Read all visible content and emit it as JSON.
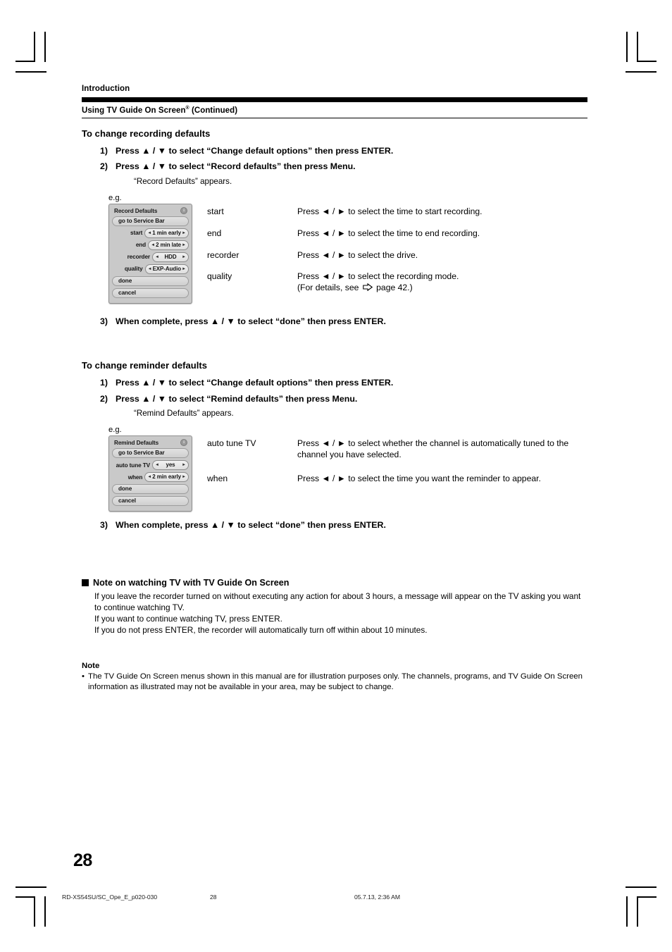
{
  "header": {
    "chapter": "Introduction",
    "section_title": "Using TV Guide On Screen",
    "section_title_sup": "®",
    "section_title_suffix": " (Continued)"
  },
  "recording": {
    "subhead": "To change recording defaults",
    "steps": [
      {
        "num": "1)",
        "text": "Press ▲ / ▼ to select “Change default options” then press ENTER."
      },
      {
        "num": "2)",
        "text": "Press ▲ / ▼ to select “Record defaults” then press Menu."
      }
    ],
    "substep": "“Record Defaults” appears.",
    "eg_label": "e.g.",
    "final_step": {
      "num": "3)",
      "text": "When complete, press ▲ / ▼ to select “done” then press ENTER."
    },
    "osd": {
      "title": "Record Defaults",
      "info_icon": "info-icon",
      "service_bar_label": "go to Service Bar",
      "fields": [
        {
          "label": "start",
          "value": "1 min early"
        },
        {
          "label": "end",
          "value": "2 min late"
        },
        {
          "label": "recorder",
          "value": "HDD"
        },
        {
          "label": "quality",
          "value": "EXP-Audio"
        }
      ],
      "done_label": "done",
      "cancel_label": "cancel",
      "arrow_left": "◄",
      "arrow_right": "►"
    },
    "descriptions": [
      {
        "term": "start",
        "def": "Press ◄ / ► to select the time to start recording."
      },
      {
        "term": "end",
        "def": "Press ◄ / ► to select the time to end recording."
      },
      {
        "term": "recorder",
        "def": "Press ◄ / ► to select the drive."
      },
      {
        "term": "quality",
        "def": "Press ◄ / ► to select the recording mode.",
        "def2_prefix": "(For details, see ",
        "def2_suffix": " page 42.)"
      }
    ]
  },
  "reminder": {
    "subhead": "To change reminder defaults",
    "steps": [
      {
        "num": "1)",
        "text": "Press ▲ / ▼ to select “Change default options” then press ENTER."
      },
      {
        "num": "2)",
        "text": "Press ▲ / ▼ to select “Remind defaults” then press Menu."
      }
    ],
    "substep": "“Remind Defaults” appears.",
    "eg_label": "e.g.",
    "final_step": {
      "num": "3)",
      "text": "When complete, press ▲ / ▼ to select “done” then press ENTER."
    },
    "osd": {
      "title": "Remind Defaults",
      "info_icon": "info-icon",
      "service_bar_label": "go to Service Bar",
      "fields": [
        {
          "label": "auto tune TV",
          "value": "yes"
        },
        {
          "label": "when",
          "value": "2 min early"
        }
      ],
      "done_label": "done",
      "cancel_label": "cancel"
    },
    "descriptions": [
      {
        "term": "auto tune TV",
        "def": "Press ◄ / ► to select whether the channel is automatically tuned to the channel you have selected."
      },
      {
        "term": "when",
        "def": "Press ◄ / ► to select the time you want the reminder to appear."
      }
    ]
  },
  "note_watching": {
    "heading": "Note on watching TV with TV Guide On Screen",
    "line1": "If you leave the recorder turned on without executing any action for about 3 hours, a message will appear on the TV asking you want to continue watching TV.",
    "line2": "If you want to continue watching TV, press ENTER.",
    "line3": "If you do not press ENTER, the recorder will automatically turn off within about 10 minutes."
  },
  "note_bottom": {
    "heading": "Note",
    "bullet": "•",
    "text": "The TV Guide On Screen menus shown in this manual are for illustration purposes only. The channels, programs, and TV Guide On Screen information as illustrated may not be available in your area, may be subject to change."
  },
  "page_number": "28",
  "footer": {
    "file": "RD-XS54SU/SC_Ope_E_p020-030",
    "page": "28",
    "date": "05.7.13, 2:36 AM"
  }
}
